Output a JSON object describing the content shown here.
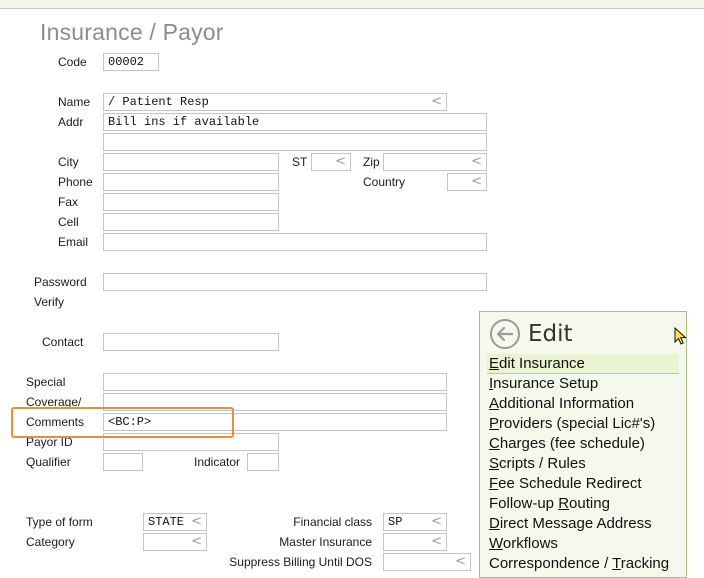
{
  "page": {
    "title": "Insurance / Payor"
  },
  "form": {
    "code_label": "Code",
    "code_value": "00002",
    "name_label": "Name",
    "name_value": "/ Patient Resp",
    "addr_label": "Addr",
    "addr_value": "Bill ins if available",
    "addr2_value": "",
    "city_label": "City",
    "city_value": "",
    "st_label": "ST",
    "st_value": "",
    "zip_label": "Zip",
    "zip_value": "",
    "phone_label": "Phone",
    "phone_value": "",
    "country_label": "Country",
    "country_value": "",
    "fax_label": "Fax",
    "fax_value": "",
    "cell_label": "Cell",
    "cell_value": "",
    "email_label": "Email",
    "email_value": "",
    "password_label": "Password",
    "password_value": "",
    "verify_label": "Verify",
    "contact_label": "Contact",
    "contact_value": "",
    "special_label": "Special",
    "special_value": "",
    "coverage_label": "Coverage/",
    "coverage_value": "",
    "comments_label": "Comments",
    "comments_value": "<BC:P>",
    "payorid_label": "Payor ID",
    "payorid_value": "",
    "qualifier_label": "Qualifier",
    "qualifier_value": "",
    "indicator_label": "Indicator",
    "indicator_value": "",
    "typeofform_label": "Type of form",
    "typeofform_value": "STATE",
    "category_label": "Category",
    "category_value": "",
    "financialclass_label": "Financial class",
    "financialclass_value": "SP",
    "masterinsurance_label": "Master Insurance",
    "masterinsurance_value": "",
    "suppress_label": "Suppress Billing Until DOS",
    "suppress_value": ""
  },
  "dropdown_glyph": "<",
  "menu": {
    "title": "Edit",
    "items": [
      {
        "pre": "",
        "key": "E",
        "post": "dit Insurance"
      },
      {
        "pre": "",
        "key": "I",
        "post": "nsurance Setup"
      },
      {
        "pre": "",
        "key": "A",
        "post": "dditional Information"
      },
      {
        "pre": "",
        "key": "P",
        "post": "roviders (special Lic#'s)"
      },
      {
        "pre": "",
        "key": "C",
        "post": "harges (fee schedule)"
      },
      {
        "pre": "",
        "key": "S",
        "post": "cripts / Rules"
      },
      {
        "pre": "",
        "key": "F",
        "post": "ee Schedule Redirect"
      },
      {
        "pre": "Follow-up ",
        "key": "R",
        "post": "outing"
      },
      {
        "pre": "",
        "key": "D",
        "post": "irect Message Address"
      },
      {
        "pre": "",
        "key": "W",
        "post": "orkflows"
      },
      {
        "pre": "Correspondence / ",
        "key": "T",
        "post": "racking"
      }
    ]
  },
  "colors": {
    "highlight_border": "#e58e3b",
    "menu_bg": "#f5f9ec",
    "menu_border": "#a8c07c",
    "title": "#8c8c8c"
  }
}
